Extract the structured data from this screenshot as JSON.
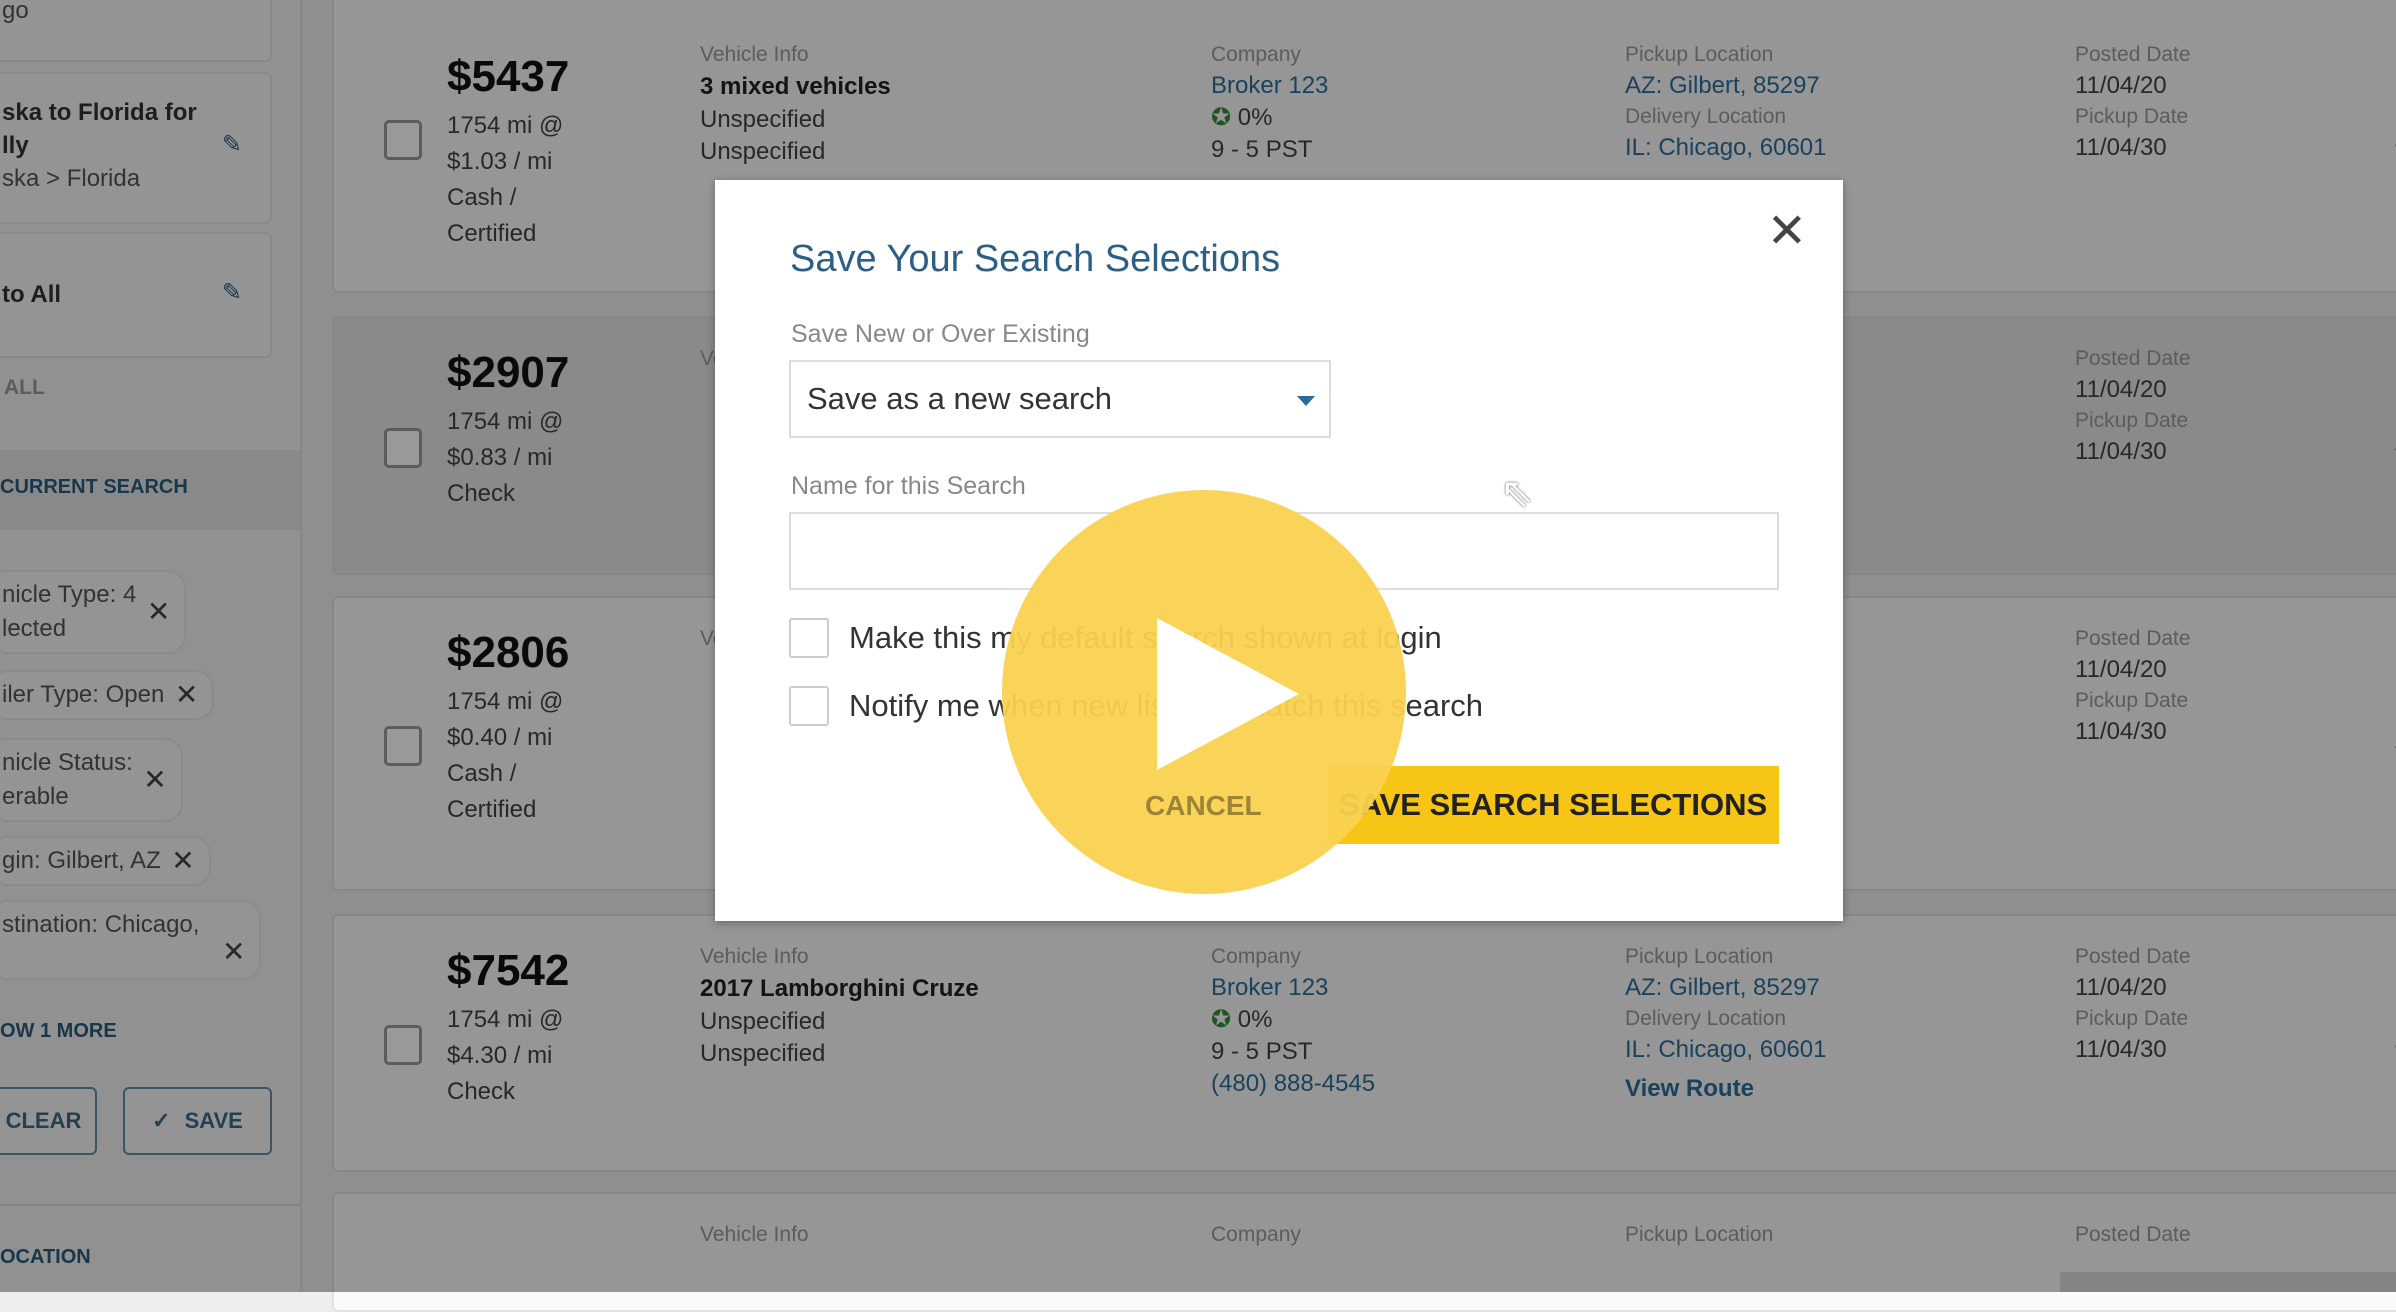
{
  "sidebar": {
    "top_fragment": "go",
    "saved_searches": [
      {
        "title": "ska to Florida for lly",
        "subtitle": "ska > Florida",
        "title_line1": "ska to Florida for",
        "title_line2": "lly"
      },
      {
        "title": "to All"
      }
    ],
    "show_all": "ALL",
    "current_search_heading": "CURRENT SEARCH",
    "chips": [
      {
        "line1": "nicle Type: 4",
        "line2": "lected"
      },
      {
        "line1": "iler Type: Open"
      },
      {
        "line1": "nicle Status:",
        "line2": "erable"
      },
      {
        "line1": "gin: Gilbert, AZ"
      },
      {
        "line1": "stination: Chicago,"
      }
    ],
    "show_more": "OW 1 MORE",
    "clear_label": "CLEAR",
    "save_label": "SAVE",
    "location_heading": "OCATION"
  },
  "labels": {
    "vehicle_info": "Vehicle Info",
    "company": "Company",
    "pickup_location": "Pickup Location",
    "delivery_location": "Delivery Location",
    "posted_date": "Posted Date",
    "pickup_date": "Pickup Date",
    "view_route": "View Route"
  },
  "rows": [
    {
      "price": "$5437",
      "miles": "1754 mi @",
      "rate": "$1.03 / mi",
      "payment1": "Cash /",
      "payment2": "Certified",
      "vehicle": "3 mixed vehicles",
      "spec1": "Unspecified",
      "spec2": "Unspecified",
      "company": "Broker 123",
      "rating": "0%",
      "hours": "9 - 5 PST",
      "pickup": "AZ: Gilbert, 85297",
      "delivery": "IL: Chicago, 60601",
      "posted": "11/04/20",
      "pickup_date": "11/04/30"
    },
    {
      "price": "$2907",
      "miles": "1754 mi @",
      "rate": "$0.83 / mi",
      "payment1": "Check",
      "posted": "11/04/20",
      "pickup_date": "11/04/30"
    },
    {
      "price": "$2806",
      "miles": "1754 mi @",
      "rate": "$0.40 / mi",
      "payment1": "Cash /",
      "payment2": "Certified",
      "posted": "11/04/20",
      "pickup_date": "11/04/30"
    },
    {
      "price": "$7542",
      "miles": "1754 mi @",
      "rate": "$4.30 / mi",
      "payment1": "Check",
      "vehicle": "2017 Lamborghini Cruze",
      "spec1": "Unspecified",
      "spec2": "Unspecified",
      "company": "Broker 123",
      "rating": "0%",
      "hours": "9 - 5 PST",
      "phone": "(480) 888-4545",
      "pickup": "AZ: Gilbert, 85297",
      "delivery": "IL: Chicago, 60601",
      "posted": "11/04/20",
      "pickup_date": "11/04/30"
    },
    {}
  ],
  "modal": {
    "title": "Save Your Search Selections",
    "save_mode_label": "Save New or Over Existing",
    "save_mode_value": "Save as a new search",
    "name_label": "Name for this Search",
    "name_value": "",
    "default_checkbox": "Make this my default search shown at login",
    "default_checked": false,
    "notify_checkbox": "Notify me when new listings match this search",
    "notify_checked": false,
    "cancel_label": "CANCEL",
    "save_label": "SAVE SEARCH SELECTIONS",
    "close_icon": "close-icon"
  },
  "video": {
    "play_icon": "play-icon",
    "accent": "#f6c515"
  },
  "colors": {
    "brand_blue": "#2b5f86",
    "accent_yellow": "#f6c515"
  }
}
